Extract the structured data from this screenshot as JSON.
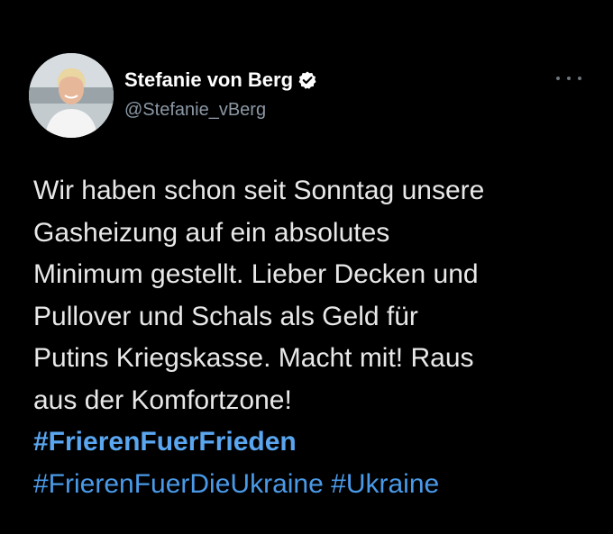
{
  "tweet": {
    "display_name": "Stefanie von Berg",
    "handle": "@Stefanie_vBerg",
    "verified": true,
    "more_icon": "more-dots-icon",
    "text_lines": [
      "Wir haben schon seit Sonntag unsere",
      "Gasheizung auf ein absolutes",
      "Minimum gestellt. Lieber Decken und",
      "Pullover und Schals als Geld für",
      "Putins Kriegskasse. Macht mit! Raus",
      "aus der Komfortzone!"
    ],
    "hashtag_line_1": "#FrierenFuerFrieden",
    "hashtag_line_2a": "#FrierenFuerDieUkraine",
    "hashtag_line_2b": "#Ukraine"
  },
  "colors": {
    "background": "#000000",
    "text": "#e8e8e8",
    "secondary": "#8b98a5",
    "link": "#4a9ae8"
  }
}
